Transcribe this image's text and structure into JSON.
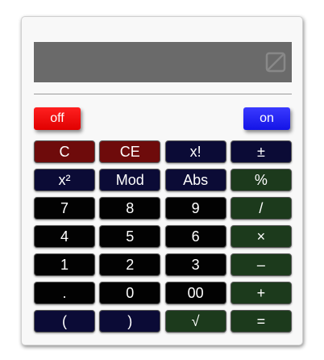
{
  "display": {
    "value": "",
    "icon": "square-slash-icon"
  },
  "power": {
    "off_label": "off",
    "on_label": "on",
    "off_color": "#ff1a1a",
    "on_color": "#2a2aff"
  },
  "colors": {
    "red": "#6e0b0b",
    "navy": "#0b0b36",
    "black": "#020202",
    "green": "#1c3a1c",
    "display_bg": "#6a6a6a"
  },
  "keys": [
    {
      "label": "C",
      "name": "clear-button",
      "style": "red"
    },
    {
      "label": "CE",
      "name": "clear-entry-button",
      "style": "red"
    },
    {
      "label": "x!",
      "name": "factorial-button",
      "style": "navy"
    },
    {
      "label": "±",
      "name": "plus-minus-button",
      "style": "navy"
    },
    {
      "label": "x²",
      "name": "square-button",
      "style": "navy"
    },
    {
      "label": "Mod",
      "name": "mod-button",
      "style": "navy"
    },
    {
      "label": "Abs",
      "name": "abs-button",
      "style": "navy"
    },
    {
      "label": "%",
      "name": "percent-button",
      "style": "green"
    },
    {
      "label": "7",
      "name": "digit-7-button",
      "style": "black"
    },
    {
      "label": "8",
      "name": "digit-8-button",
      "style": "black"
    },
    {
      "label": "9",
      "name": "digit-9-button",
      "style": "black"
    },
    {
      "label": "/",
      "name": "divide-button",
      "style": "green"
    },
    {
      "label": "4",
      "name": "digit-4-button",
      "style": "black"
    },
    {
      "label": "5",
      "name": "digit-5-button",
      "style": "black"
    },
    {
      "label": "6",
      "name": "digit-6-button",
      "style": "black"
    },
    {
      "label": "×",
      "name": "multiply-button",
      "style": "green"
    },
    {
      "label": "1",
      "name": "digit-1-button",
      "style": "black"
    },
    {
      "label": "2",
      "name": "digit-2-button",
      "style": "black"
    },
    {
      "label": "3",
      "name": "digit-3-button",
      "style": "black"
    },
    {
      "label": "–",
      "name": "subtract-button",
      "style": "green"
    },
    {
      "label": ".",
      "name": "decimal-point-button",
      "style": "black"
    },
    {
      "label": "0",
      "name": "digit-0-button",
      "style": "black"
    },
    {
      "label": "00",
      "name": "double-zero-button",
      "style": "black"
    },
    {
      "label": "+",
      "name": "add-button",
      "style": "green"
    },
    {
      "label": "(",
      "name": "open-paren-button",
      "style": "navy"
    },
    {
      "label": ")",
      "name": "close-paren-button",
      "style": "navy"
    },
    {
      "label": "√",
      "name": "square-root-button",
      "style": "green"
    },
    {
      "label": "=",
      "name": "equals-button",
      "style": "green"
    }
  ]
}
